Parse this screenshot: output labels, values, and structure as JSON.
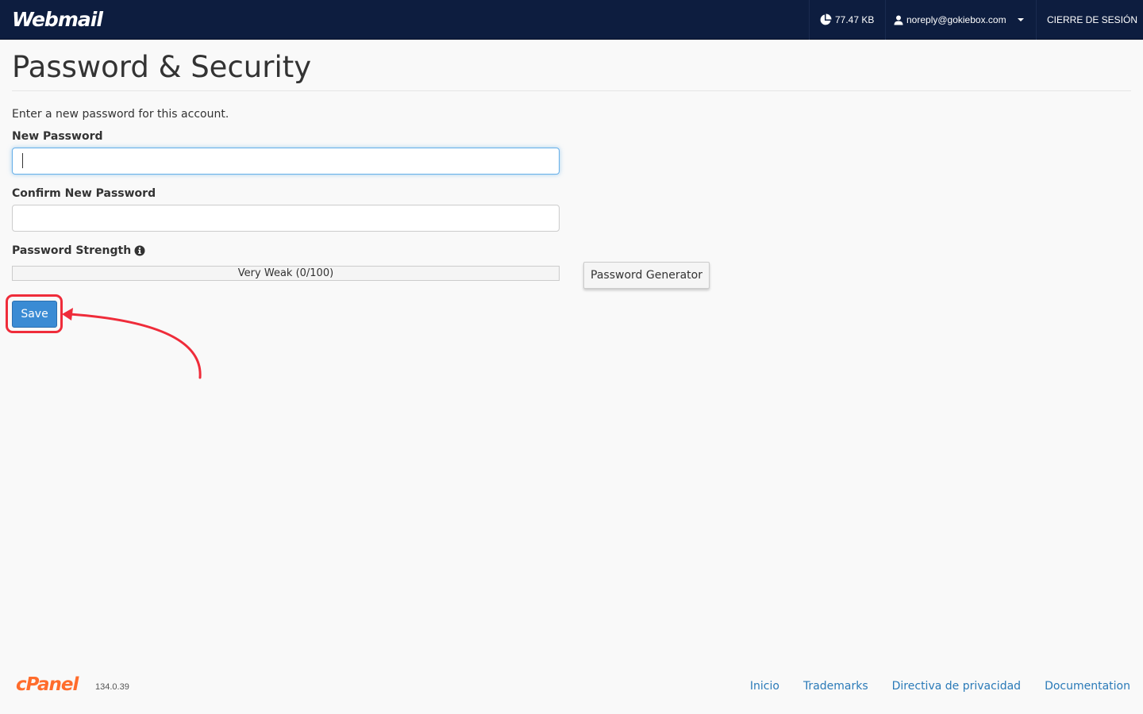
{
  "header": {
    "brand": "Webmail",
    "disk_usage": "77.47 KB",
    "user": "noreply@gokiebox.com",
    "logout": "CIERRE DE SESIÓN"
  },
  "main": {
    "title": "Password & Security",
    "intro": "Enter a new password for this account.",
    "new_password_label": "New Password",
    "new_password_value": "",
    "confirm_password_label": "Confirm New Password",
    "confirm_password_value": "",
    "strength_label": "Password Strength",
    "strength_text": "Very Weak (0/100)",
    "strength_value": 0,
    "generator_label": "Password Generator",
    "save_label": "Save"
  },
  "footer": {
    "logo": "cPanel",
    "version": "134.0.39",
    "links": [
      "Inicio",
      "Trademarks",
      "Directiva de privacidad",
      "Documentation"
    ]
  },
  "colors": {
    "navbar": "#0d1d3f",
    "primary": "#3a8bd4",
    "annotation": "#ef2c3a",
    "link": "#2a7ab8",
    "cpanel_orange": "#ff6c2c"
  },
  "icons": {
    "disk": "pie-chart-icon",
    "user": "user-icon",
    "logout": "sign-out-icon",
    "info": "info-circle-icon"
  }
}
